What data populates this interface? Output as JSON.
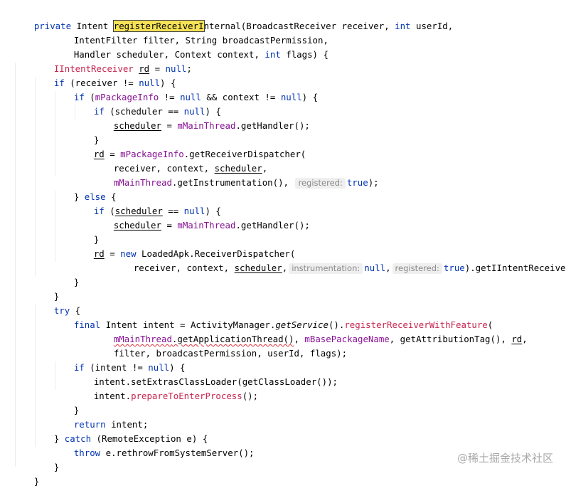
{
  "code": {
    "l1": {
      "k": "private",
      "t": " Intent ",
      "sel": "registerReceiverI",
      "rest": "nternal",
      "a": "(BroadcastReceiver receiver, ",
      "k2": "int",
      "b": " userId,"
    },
    "l2": "IntentFilter filter, String broadcastPermission,",
    "l3": {
      "a": "Handler scheduler, Context context, ",
      "k": "int",
      "b": " flags) {"
    },
    "l4": {
      "t": "IIntentReceiver",
      "sp": " ",
      "v": "rd",
      "eq": " = ",
      "n": "null",
      "e": ";"
    },
    "l5": {
      "k": "if",
      "a": " (receiver != ",
      "n": "null",
      "b": ") {"
    },
    "l6": {
      "k": "if",
      "a": " (",
      "f": "mPackageInfo",
      "b": " != ",
      "n": "null",
      "c": " && context != ",
      "n2": "null",
      "d": ") {"
    },
    "l7": {
      "k": "if",
      "a": " (scheduler == ",
      "n": "null",
      "b": ") {"
    },
    "l8": {
      "v": "scheduler",
      "a": " = ",
      "f": "mMainThread",
      "b": ".getHandler();"
    },
    "l9": "}",
    "l10": {
      "v": "rd",
      "a": " = ",
      "f": "mPackageInfo",
      "b": ".getReceiverDispatcher("
    },
    "l11": {
      "a": "receiver, context, ",
      "v": "scheduler",
      "b": ","
    },
    "l12": {
      "f": "mMainThread",
      "a": ".getInstrumentation(), ",
      "h": "registered:",
      "k": "true",
      "b": ");"
    },
    "l13": {
      "a": "} ",
      "k": "else",
      "b": " {"
    },
    "l14": {
      "k": "if",
      "a": " (",
      "v": "scheduler",
      "b": " == ",
      "n": "null",
      "c": ") {"
    },
    "l15": {
      "v": "scheduler",
      "a": " = ",
      "f": "mMainThread",
      "b": ".getHandler();"
    },
    "l16": "}",
    "l17": {
      "v": "rd",
      "a": " = ",
      "k": "new",
      "b": " LoadedApk.ReceiverDispatcher("
    },
    "l18": {
      "a": "receiver, context, ",
      "v": "scheduler",
      "b": ",",
      "h1": "instrumentation:",
      "n": "null",
      "c": ",",
      "h2": "registered:",
      "k": "true",
      "d": ").getIIntentReceiver();"
    },
    "l19": "}",
    "l20": "}",
    "l21": {
      "k": "try",
      "a": " {"
    },
    "l22": {
      "k": "final",
      "a": " Intent intent = ActivityManager.",
      "i": "getService",
      "b": "().",
      "m": "registerReceiverWithFeature",
      "c": "("
    },
    "l23": {
      "f": "mMainThread",
      "a": ".getApplicationThread()",
      "b": ", ",
      "f2": "mBasePackageName",
      "c": ", getAttributionTag(), ",
      "v": "rd",
      "d": ","
    },
    "l24": "filter, broadcastPermission, userId, flags);",
    "l25": {
      "k": "if",
      "a": " (intent != ",
      "n": "null",
      "b": ") {"
    },
    "l26": "intent.setExtrasClassLoader(getClassLoader());",
    "l27": {
      "a": "intent.",
      "m": "prepareToEnterProcess",
      "b": "();"
    },
    "l28": "}",
    "l29": {
      "k": "return",
      "a": " intent;"
    },
    "l30": {
      "a": "} ",
      "k": "catch",
      "b": " (RemoteException e) {"
    },
    "l31": {
      "k": "throw",
      "a": " e.rethrowFromSystemServer();"
    },
    "l32": "}",
    "l33": "}"
  },
  "watermark": "@稀土掘金技术社区",
  "colors": {
    "keyword": "#0033b3",
    "field": "#871094",
    "error": "#c7254e",
    "hint_bg": "#efefef",
    "selection": "#f5e256"
  }
}
